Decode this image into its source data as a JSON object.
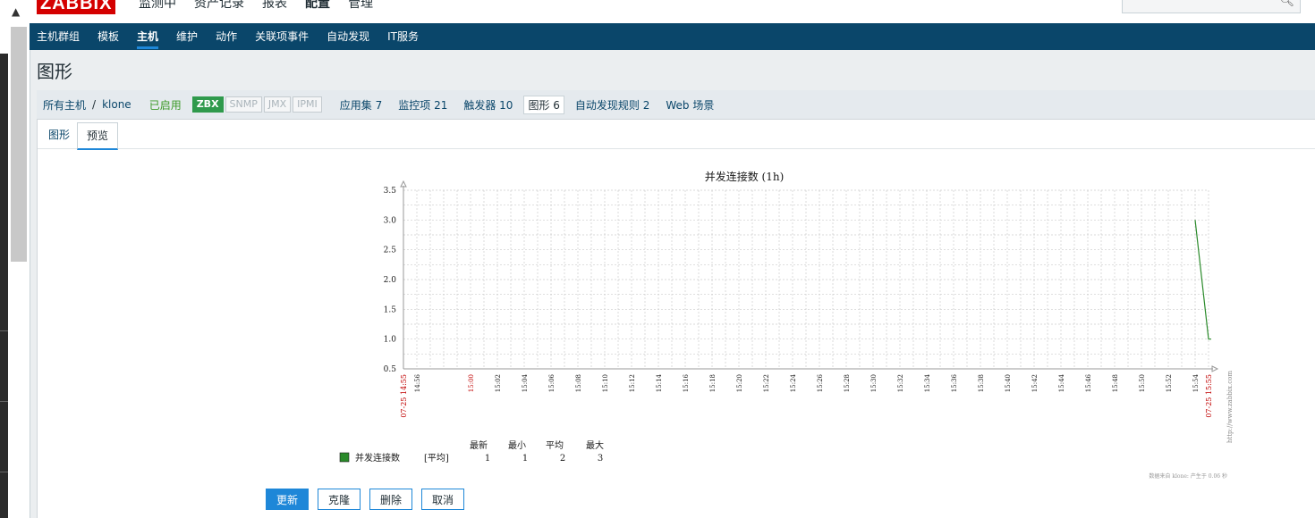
{
  "app": {
    "logo": "ZABBIX"
  },
  "topnav": [
    "监测中",
    "资产记录",
    "报表",
    "配置",
    "管理"
  ],
  "subnav": [
    "主机群组",
    "模板",
    "主机",
    "维护",
    "动作",
    "关联项事件",
    "自动发现",
    "IT服务"
  ],
  "page_title": "图形",
  "hostbar": {
    "all_hosts": "所有主机",
    "separator": "/",
    "host": "klone",
    "enabled": "已启用",
    "badges": [
      "ZBX",
      "SNMP",
      "JMX",
      "IPMI"
    ],
    "links": [
      "应用集 7",
      "监控项 21",
      "触发器 10",
      "图形 6",
      "自动发现规则 2",
      "Web 场景"
    ]
  },
  "tabs": [
    "图形",
    "预览"
  ],
  "chart_data": {
    "type": "line",
    "title": "并发连接数 (1h)",
    "ylim": [
      0.5,
      3.5
    ],
    "y_ticks": [
      "3.5",
      "3.0",
      "2.5",
      "2.0",
      "1.5",
      "1.0",
      "0.5"
    ],
    "x_start_label": "07-25 14:55",
    "x_end_label": "07-25 15:55",
    "x_ticks": [
      "14:56",
      "15:00",
      "15:02",
      "15:04",
      "15:06",
      "15:08",
      "15:10",
      "15:12",
      "15:14",
      "15:16",
      "15:18",
      "15:20",
      "15:22",
      "15:24",
      "15:26",
      "15:28",
      "15:30",
      "15:32",
      "15:34",
      "15:36",
      "15:38",
      "15:40",
      "15:42",
      "15:44",
      "15:46",
      "15:48",
      "15:50",
      "15:52",
      "15:54"
    ],
    "red_ticks": [
      "15:00"
    ],
    "series": [
      {
        "name": "并发连接数",
        "color": "#2a8a2a",
        "points": [
          [
            "15:54",
            3
          ],
          [
            "15:55",
            1
          ]
        ]
      }
    ],
    "legend": {
      "headers": [
        "最新",
        "最小",
        "平均",
        "最大"
      ],
      "item": "并发连接数",
      "func": "[平均]",
      "values": [
        "1",
        "1",
        "2",
        "3"
      ]
    },
    "watermark": "http://www.zabbix.com",
    "footer_note": "数据来自 klone: 产生于 0.06 秒"
  },
  "buttons": {
    "update": "更新",
    "clone": "克隆",
    "delete": "删除",
    "cancel": "取消"
  },
  "search": {
    "placeholder": ""
  },
  "colors": {
    "brand": "#d40000",
    "nav": "#0a466a",
    "accent": "#1e87d8",
    "series": "#2a8a2a"
  }
}
